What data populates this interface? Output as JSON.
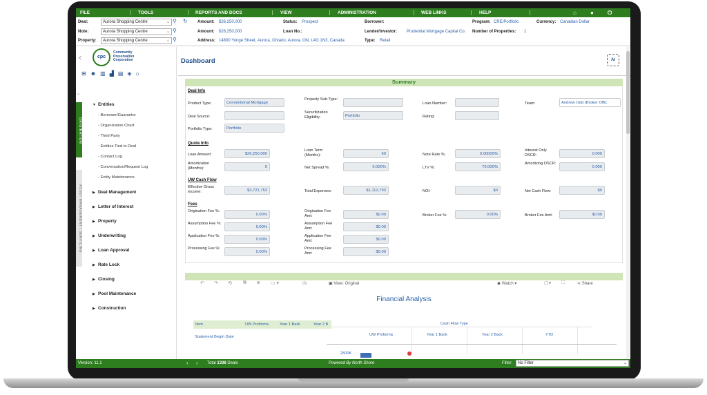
{
  "menu": {
    "file": "FILE",
    "tools": "TOOLS",
    "reports": "REPORTS AND DOCS",
    "view": "VIEW",
    "admin": "ADMINISTRATION",
    "links": "WEB LINKS",
    "help": "HELP"
  },
  "info": {
    "deal_label": "Deal:",
    "deal_value": "Aurora Shopping Centre",
    "note_label": "Note:",
    "note_value": "Aurora Shopping Centre",
    "property_label": "Property:",
    "property_value": "Aurora Shopping Centre",
    "amount1_label": "Amount:",
    "amount1_value": "$26,250,000",
    "amount2_label": "Amount:",
    "amount2_value": "$26,250,000",
    "address_label": "Address:",
    "address_value": "14800 Yonge Street, Aurora, Ontario, Aurora, ON, L4G 1N3, Canada",
    "status_label": "Status:",
    "status_value": "Prospect",
    "loanno_label": "Loan No.:",
    "loanno_value": "",
    "type_label": "Type:",
    "type_value": "Retail",
    "borrower_label": "Borrower:",
    "borrower_value": "",
    "lender_label": "Lender/Investor:",
    "lender_value": "Prudential Mortgage Capital Co.",
    "program_label": "Program:",
    "program_value": "CRE/Portfolio",
    "numprop_label": "Number of Properties:",
    "numprop_value": "1",
    "currency_label": "Currency:",
    "currency_value": "Canadian Dollar"
  },
  "sidebar": {
    "org_name_1": "Community",
    "org_name_2": "Preservation",
    "org_name_3": "Corporation",
    "logo_text": "cpc",
    "vtab_origination": "ORIGINATION",
    "vtab_asset": "ASSET MANAGEMENT / SERVICING",
    "entities": "Entities",
    "sub": [
      "Borrower/Guarantor",
      "Organization Chart",
      "Third Party",
      "Entities Tied to Deal",
      "Contact Log",
      "Conversation/Request Log",
      "Entity Maintenance"
    ],
    "sections": [
      "Deal Management",
      "Letter of Interest",
      "Property",
      "Underwriting",
      "Loan Approval",
      "Rate Lock",
      "Closing",
      "Pool Maintenance",
      "Construction"
    ]
  },
  "dashboard": {
    "title": "Dashboard",
    "ai": "AI",
    "summary_title": "Summary",
    "deal_info": "Deal Info",
    "quote_info": "Quote Info",
    "uw_cash_flow": "UW Cash Flow",
    "fees": "Fees",
    "fields": {
      "product_type_l": "Product Type:",
      "product_type_v": "Conventional Mortgage",
      "property_subtype_l": "Property Sub-Type:",
      "property_subtype_v": "",
      "loan_number_l": "Loan Number:",
      "loan_number_v": "",
      "team_l": "Team:",
      "team_v": "Andrew Odd (Broker Offic",
      "deal_source_l": "Deal Source:",
      "deal_source_v": "",
      "securitization_l": "Securitization Eligibility:",
      "securitization_v": "Portfolio",
      "rating_l": "Rating:",
      "rating_v": "",
      "portfolio_type_l": "Portfolio Type:",
      "portfolio_type_v": "Portfolio",
      "loan_amount_l": "Loan Amount:",
      "loan_amount_v": "$26,250,000",
      "loan_term_l": "Loan Term (Months):",
      "loan_term_v": "60",
      "note_rate_l": "Note Rate %:",
      "note_rate_v": "0.00000%",
      "interest_only_l": "Interest Only DSCR:",
      "interest_only_v": "0.000",
      "amortization_l": "Amortization (Months):",
      "amortization_v": "0",
      "net_spread_l": "Net Spread %:",
      "net_spread_v": "0.000%",
      "ltv_l": "LTV %:",
      "ltv_v": "70.000%",
      "amortizing_dscr_l": "Amortizing DSCR:",
      "amortizing_dscr_v": "0.000",
      "egi_l": "Effective Gross Income:",
      "egi_v": "$3,721,753",
      "total_exp_l": "Total Expenses:",
      "total_exp_v": "$1,112,793",
      "noi_l": "NOI:",
      "noi_v": "$0",
      "ncf_l": "Net Cash Flow:",
      "ncf_v": "$0",
      "orig_fee_pct_l": "Origination Fee %:",
      "orig_fee_pct_v": "0.00%",
      "orig_fee_amt_l": "Origination Fee Amt:",
      "orig_fee_amt_v": "$0.00",
      "broker_fee_pct_l": "Broker Fee %:",
      "broker_fee_pct_v": "0.00%",
      "broker_fee_amt_l": "Broker Fee Amt:",
      "broker_fee_amt_v": "$0.00",
      "assum_fee_pct_l": "Assumption Fee %:",
      "assum_fee_pct_v": "0.00%",
      "assum_fee_amt_l": "Assumption Fee Amt:",
      "assum_fee_amt_v": "$0.00",
      "app_fee_pct_l": "Application Fee %:",
      "app_fee_pct_v": "0.00%",
      "app_fee_amt_l": "Application Fee Amt:",
      "app_fee_amt_v": "$0.00",
      "proc_fee_pct_l": "Processing Fee %:",
      "proc_fee_pct_v": "0.00%",
      "proc_fee_amt_l": "Processing Fee Amt:",
      "proc_fee_amt_v": "$0.00"
    }
  },
  "financial": {
    "view_label": "View: Original",
    "watch_label": "Watch",
    "share_label": "Share",
    "title": "Financial Analysis",
    "table_headers": [
      "Item",
      "UW Proforma",
      "Year 1 Back",
      "Year 2 B"
    ],
    "row1": "Statement Begin Date",
    "chart_title": "Cash Flow Type",
    "chart_cols": [
      "UW Proforma",
      "Year 1 Back",
      "Year 2 Back",
      "YTD"
    ],
    "y_tick": "2500K"
  },
  "status": {
    "version": "Version: 11.1",
    "total_label": "Total",
    "total_count": "1338",
    "total_suffix": "Deals",
    "powered": "Powered By North Shore",
    "filter_label": "Filter:",
    "filter_value": "No Filter"
  },
  "colors": {
    "brand_green": "#2e7d1f",
    "accent_blue": "#2a5fa8",
    "summary_bg": "#cfe5b8"
  }
}
